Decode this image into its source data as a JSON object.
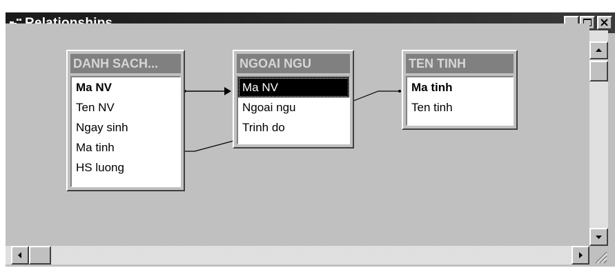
{
  "window": {
    "title": "Relationships",
    "icon": "relationships-icon",
    "buttons": [
      "minimize-icon",
      "maximize-icon",
      "close-icon"
    ]
  },
  "tables": [
    {
      "name": "DANH SACH...",
      "fields": [
        {
          "label": "Ma NV",
          "primary_key": true
        },
        {
          "label": "Ten NV"
        },
        {
          "label": "Ngay sinh"
        },
        {
          "label": "Ma tinh"
        },
        {
          "label": "HS luong"
        }
      ]
    },
    {
      "name": "NGOAI NGU",
      "fields": [
        {
          "label": "Ma NV",
          "selected": true
        },
        {
          "label": "Ngoai ngu"
        },
        {
          "label": "Trinh do"
        }
      ]
    },
    {
      "name": "TEN TINH",
      "fields": [
        {
          "label": "Ma tinh",
          "primary_key": true
        },
        {
          "label": "Ten tinh"
        }
      ]
    }
  ],
  "relationships": [
    {
      "from": "DANH SACH....Ma NV",
      "to": "NGOAI NGU.Ma NV"
    },
    {
      "from": "DANH SACH....Ma tinh",
      "to": "NGOAI NGU.Trinh do"
    },
    {
      "from": "NGOAI NGU.Ma NV",
      "to": "TEN TINH.Ma tinh"
    }
  ],
  "colors": {
    "window_bg": "#c0c0c0",
    "title_bg": "#1a1a1a",
    "table_title_bg": "#808080",
    "selection": "#000000"
  }
}
